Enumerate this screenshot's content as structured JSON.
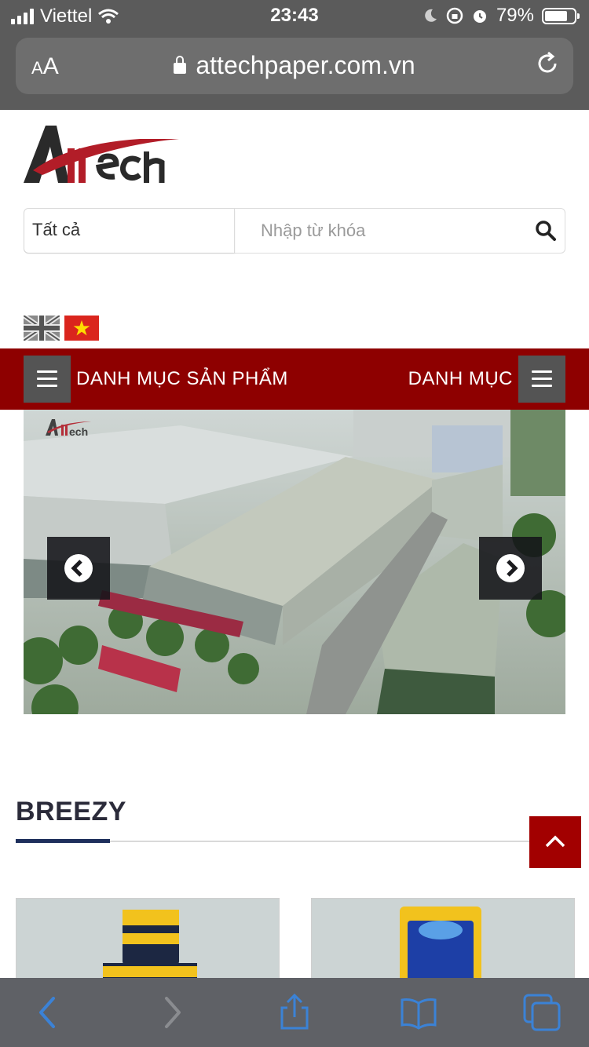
{
  "status_bar": {
    "carrier": "Viettel",
    "time": "23:43",
    "battery_percent": "79%"
  },
  "browser": {
    "text_size_label": "AA",
    "url": "attechpaper.com.vn"
  },
  "header": {
    "logo_text": "ATtech",
    "search": {
      "category_value": "Tất cả",
      "placeholder": "Nhập từ khóa"
    },
    "languages": [
      "English",
      "Tiếng Việt"
    ]
  },
  "nav": {
    "left_label": "DANH MỤC SẢN PHẨM",
    "right_label": "DANH MỤC"
  },
  "slider": {
    "watermark": "ATtech"
  },
  "section": {
    "title": "BREEZY"
  },
  "colors": {
    "brand_red": "#8e0000",
    "accent_navy": "#1e2f5c",
    "ios_blue": "#3b82d6"
  }
}
